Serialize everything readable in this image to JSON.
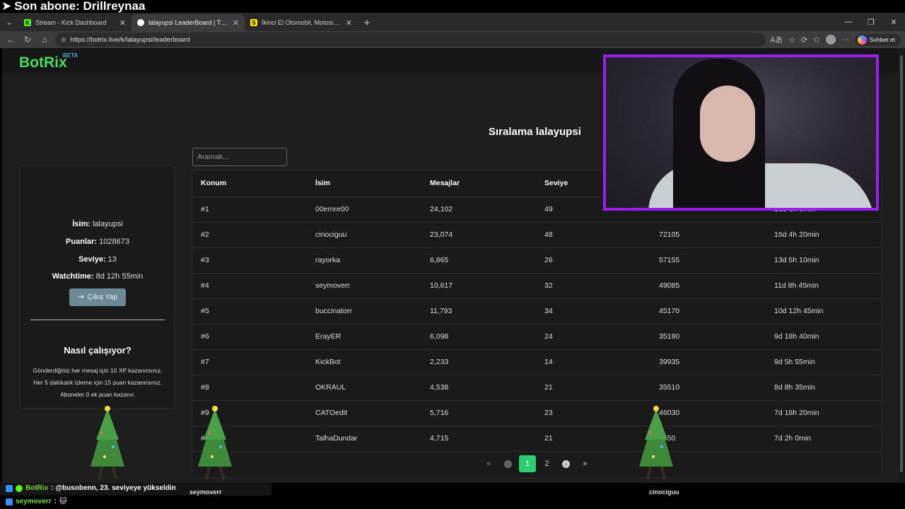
{
  "overlay": {
    "arrow": "➤",
    "text": "Son abone: Drillreynaa"
  },
  "browser": {
    "tabs": [
      {
        "title": "Stream - Kick Dashboard",
        "fav": "K",
        "fav_color": "#53fc18"
      },
      {
        "title": "lalayupsi LeaderBoard | The best C",
        "fav": "",
        "fav_color": "#ffffff"
      },
      {
        "title": "İkinci El Otomobil, Motosiklet Mo",
        "fav": "S",
        "fav_color": "#ffe800"
      }
    ],
    "url": "https://botrix.live/k/lalayupsi/leaderboard",
    "copilot_label": "Sohbet et"
  },
  "site": {
    "logo": "BotRix",
    "beta": "BETA",
    "heading": "Sıralama lalayupsi",
    "search_placeholder": "Aramak..."
  },
  "profile": {
    "name_label": "İsim:",
    "name": "lalayupsi",
    "points_label": "Puanlar:",
    "points": "1028673",
    "level_label": "Seviye:",
    "level": "13",
    "watch_label": "Watchtime:",
    "watch": "8d 12h 55min",
    "logout": "Çıkış Yap",
    "how_title": "Nasıl çalışıyor?",
    "how_lines": [
      "Gönderdiğiniz her mesaj için 10 XP kazanırsınız.",
      "Her 5 dakikalık izleme için 15 puan kazanırsınız.",
      "Aboneler 0 ek puan kazanır."
    ]
  },
  "table": {
    "headers": [
      "Konum",
      "İsim",
      "Mesajlar",
      "Seviye"
    ],
    "rows": [
      [
        "#1",
        "00emre00",
        "24,102",
        "49",
        "",
        "16d 6h 0min"
      ],
      [
        "#2",
        "cinociguu",
        "23,074",
        "48",
        "72105",
        "16d 4h 20min"
      ],
      [
        "#3",
        "rayorka",
        "6,865",
        "26",
        "57155",
        "13d 5h 10min"
      ],
      [
        "#4",
        "seymoverr",
        "10,617",
        "32",
        "49085",
        "11d 8h 45min"
      ],
      [
        "#5",
        "buccinatorr",
        "11,793",
        "34",
        "45170",
        "10d 12h 45min"
      ],
      [
        "#6",
        "ErayER",
        "6,098",
        "24",
        "35180",
        "9d 18h 40min"
      ],
      [
        "#7",
        "KickBot",
        "2,233",
        "14",
        "39935",
        "9d 5h 55min"
      ],
      [
        "#8",
        "OKRAUL",
        "4,538",
        "21",
        "35510",
        "8d 8h 35min"
      ],
      [
        "#9",
        "CATOedit",
        "5,716",
        "23",
        "46030",
        "7d 18h 20min"
      ],
      [
        "#",
        "TalhaDundar",
        "4,715",
        "21",
        "2450",
        "7d 2h 0min"
      ]
    ]
  },
  "pager": {
    "pages": [
      "1",
      "2"
    ],
    "current": "1"
  },
  "chat": {
    "line1_user": "BotRix",
    "line1_text": ": @busobenn, 23. seviyeye yükseldin",
    "line2_user": "seymoverr",
    "line2_text": ":"
  },
  "tree_labels": [
    "seymoverr",
    "cinociguu"
  ]
}
